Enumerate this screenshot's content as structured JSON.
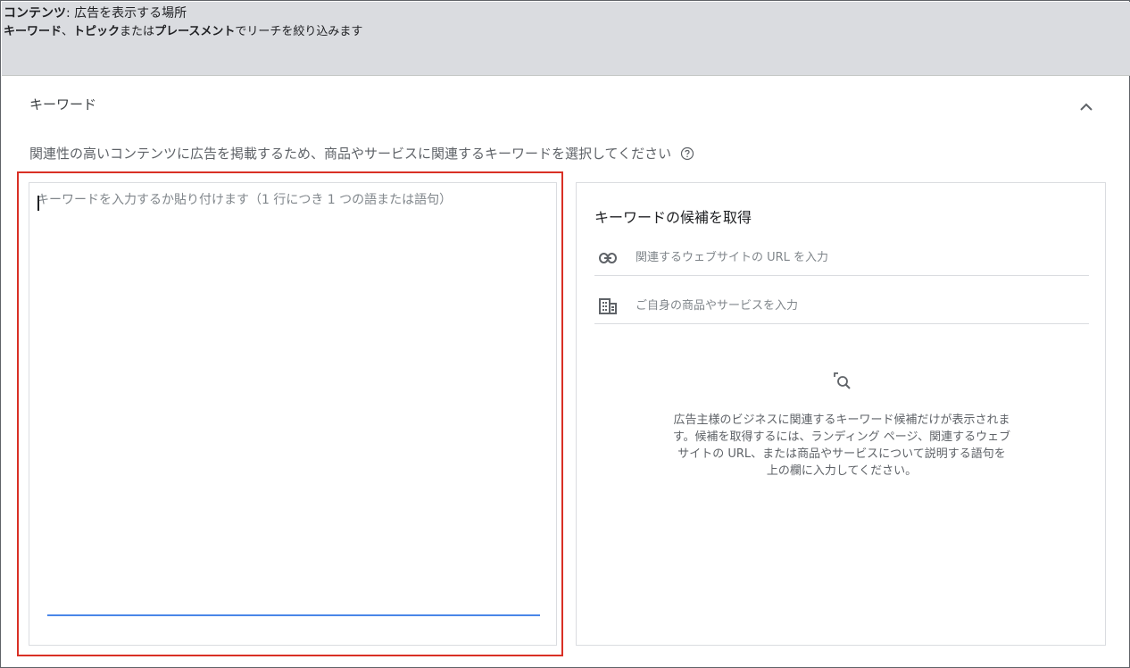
{
  "header": {
    "line1_bold": "コンテンツ",
    "line1_rest": ": 広告を表示する場所",
    "line2_a": "キーワード",
    "line2_sep1": "、",
    "line2_b": "トピック",
    "line2_sep2": "または",
    "line2_c": "プレースメント",
    "line2_rest": "でリーチを絞り込みます"
  },
  "keywords_section": {
    "title": "キーワード",
    "description": "関連性の高いコンテンツに広告を掲載するため、商品やサービスに関連するキーワードを選択してください",
    "textarea_placeholder": "キーワードを入力するか貼り付けます（1 行につき 1 つの語または語句）",
    "textarea_value": ""
  },
  "ideas_panel": {
    "title": "キーワードの候補を取得",
    "url_field": {
      "placeholder": "関連するウェブサイトの URL を入力",
      "value": "",
      "icon": "link-icon"
    },
    "product_field": {
      "placeholder": "ご自身の商品やサービスを入力",
      "value": "",
      "icon": "store-icon"
    },
    "empty_state_icon": "search-document-icon",
    "empty_state_text": "広告主様のビジネスに関連するキーワード候補だけが表示されます。候補を取得するには、ランディング ページ、関連するウェブサイトの URL、または商品やサービスについて説明する語句を上の欄に入力してください。"
  },
  "colors": {
    "header_bg": "#dadce0",
    "highlight": "#d93025",
    "focus_underline": "#4a86e8",
    "text_primary": "#202124",
    "text_secondary": "#5f6368"
  }
}
